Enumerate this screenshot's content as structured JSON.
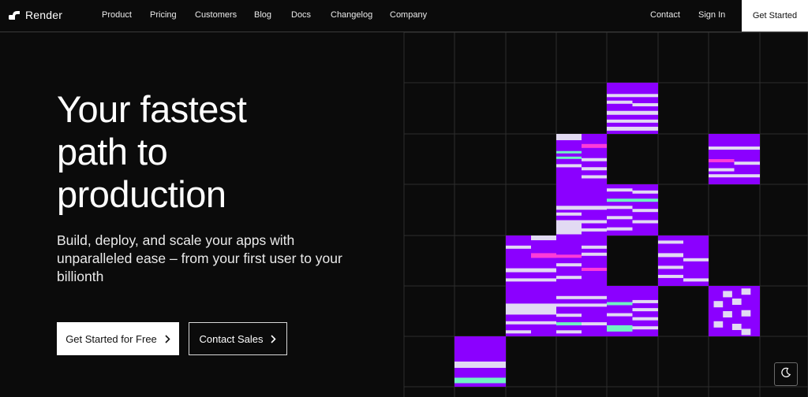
{
  "brand": {
    "name": "Render",
    "icon": "render-logo-icon"
  },
  "nav": {
    "items": [
      {
        "label": "Product"
      },
      {
        "label": "Pricing"
      },
      {
        "label": "Customers"
      },
      {
        "label": "Blog"
      },
      {
        "label": "Docs"
      },
      {
        "label": "Changelog"
      },
      {
        "label": "Company"
      }
    ],
    "contact": "Contact",
    "sign_in": "Sign In",
    "get_started": "Get Started"
  },
  "hero": {
    "title_lines": [
      "Your fastest",
      "path to",
      "production"
    ],
    "subtitle": "Build, deploy, and scale your apps with unparalleled ease – from your first user to your billionth",
    "primary_cta": "Get Started for Free",
    "secondary_cta": "Contact Sales",
    "cta_icon": "chevron-right-icon"
  },
  "theme_toggle": {
    "icon": "moon-icon"
  },
  "colors": {
    "background": "#0b0b0b",
    "purple": "#8B00FF",
    "lavender": "#E2DAF3",
    "pink": "#FF3BD8",
    "mint": "#6FF2C2",
    "grid_line": "#2e2e2e"
  }
}
